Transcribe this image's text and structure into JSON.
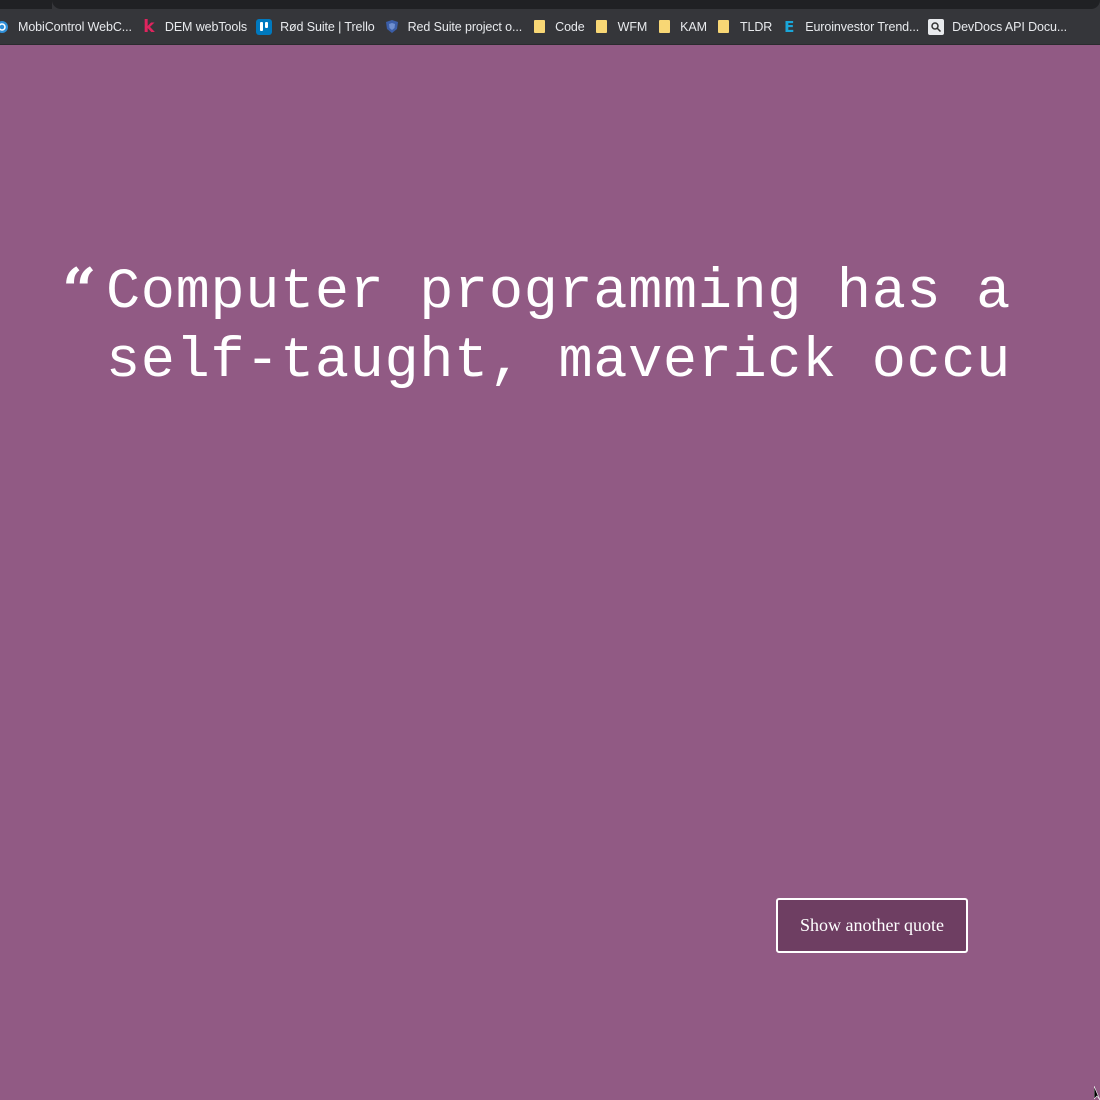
{
  "bookmarks": [
    {
      "label": "MobiControl WebC...",
      "icon": "mobicontrol-icon"
    },
    {
      "label": "DEM webTools",
      "icon": "k-logo-icon"
    },
    {
      "label": "Rød Suite | Trello",
      "icon": "trello-icon"
    },
    {
      "label": "Red Suite project o...",
      "icon": "shield-icon"
    },
    {
      "label": "Code",
      "icon": "folder-icon"
    },
    {
      "label": "WFM",
      "icon": "folder-icon"
    },
    {
      "label": "KAM",
      "icon": "folder-icon"
    },
    {
      "label": "TLDR",
      "icon": "folder-icon"
    },
    {
      "label": "Euroinvestor Trend...",
      "icon": "e-logo-icon"
    },
    {
      "label": "DevDocs API Docu...",
      "icon": "devdocs-icon"
    }
  ],
  "quote": {
    "mark": "“",
    "line1": "Computer programming has a",
    "line2": "self-taught, maverick occu"
  },
  "button": {
    "label": "Show another quote"
  },
  "colors": {
    "background": "#915a84",
    "button_bg": "#6e3e62",
    "text": "#ffffff"
  }
}
